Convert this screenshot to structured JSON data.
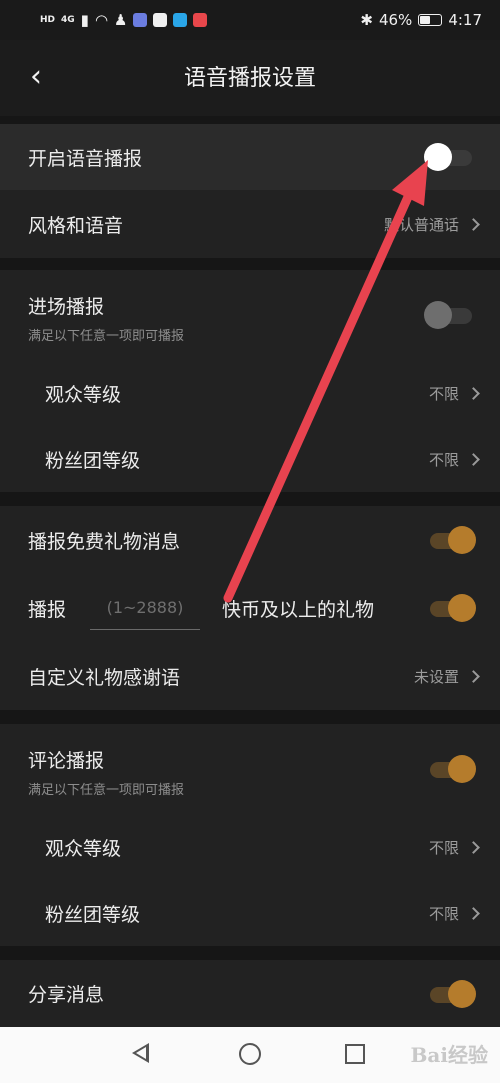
{
  "status_bar": {
    "left_label": "HD",
    "signal_label": "4G",
    "battery_percent": "46%",
    "time": "4:17"
  },
  "header": {
    "title": "语音播报设置",
    "back_icon": "chevron-left-icon"
  },
  "rows": {
    "enable_voice": {
      "label": "开启语音播报",
      "toggle": "off"
    },
    "style_voice": {
      "label": "风格和语音",
      "value": "默认普通话"
    },
    "entry_broadcast": {
      "label": "进场播报",
      "hint": "满足以下任意一项即可播报",
      "toggle": "off"
    },
    "entry_audience_level": {
      "label": "观众等级",
      "value": "不限"
    },
    "entry_fan_level": {
      "label": "粉丝团等级",
      "value": "不限"
    },
    "free_gift": {
      "label": "播报免费礼物消息",
      "toggle": "on"
    },
    "gift_threshold": {
      "prefix": "播报",
      "placeholder": "(1~2888)",
      "suffix": "快币及以上的礼物",
      "toggle": "on"
    },
    "custom_thanks": {
      "label": "自定义礼物感谢语",
      "value": "未设置"
    },
    "comment_broadcast": {
      "label": "评论播报",
      "hint": "满足以下任意一项即可播报",
      "toggle": "on"
    },
    "comment_audience_level": {
      "label": "观众等级",
      "value": "不限"
    },
    "comment_fan_level": {
      "label": "粉丝团等级",
      "value": "不限"
    },
    "share_message": {
      "label": "分享消息",
      "toggle": "on"
    }
  },
  "nav_bar": {
    "watermark": "Bai经验"
  },
  "colors": {
    "accent": "#b57c2c",
    "annotation_arrow": "#e8434f",
    "background": "#161616",
    "section": "#222222"
  }
}
